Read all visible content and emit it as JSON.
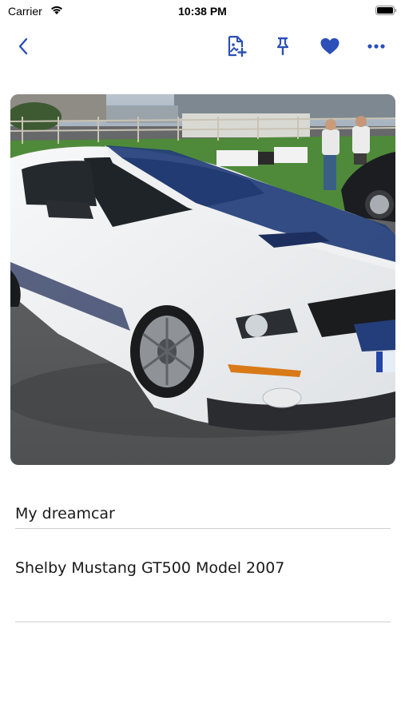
{
  "status_bar": {
    "carrier": "Carrier",
    "time": "10:38 PM",
    "wifi_icon": "wifi-icon",
    "battery_icon": "battery-icon"
  },
  "toolbar": {
    "back_icon": "chevron-left-icon",
    "add_image_icon": "file-image-plus-icon",
    "pin_icon": "pin-icon",
    "favorite_icon": "heart-icon",
    "more_icon": "ellipsis-icon",
    "accent_color": "#2c4fb8"
  },
  "note": {
    "image_subject": "white car with blue racing stripes",
    "title": "My dreamcar",
    "description": "Shelby Mustang GT500 Model 2007"
  },
  "colors": {
    "divider": "#cfcfcf",
    "background": "#ffffff"
  }
}
